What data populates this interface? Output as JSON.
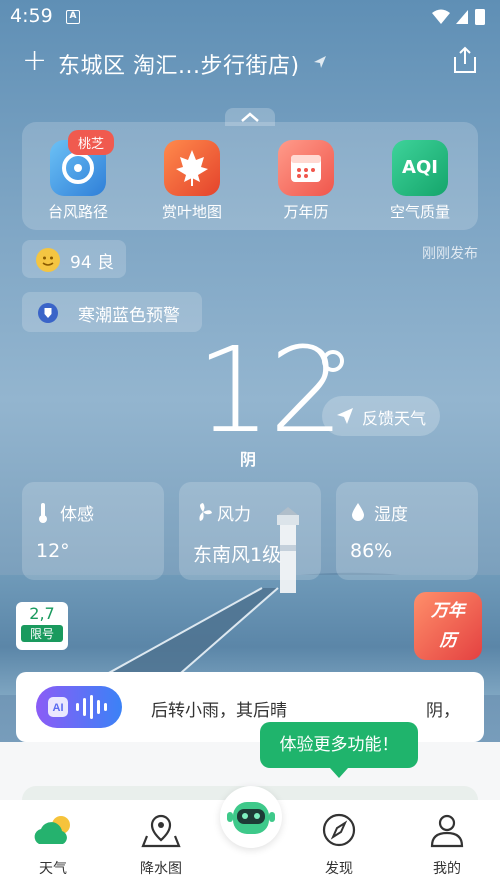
{
  "status_bar": {
    "time": "4:59",
    "notif_letter": "A"
  },
  "header": {
    "add_label": "+",
    "location": "东城区 淘汇...步行街店)"
  },
  "shortcuts": {
    "badge": "桃芝",
    "items": [
      {
        "label": "台风路径",
        "icon": "typhoon-icon"
      },
      {
        "label": "赏叶地图",
        "icon": "maple-leaf-icon"
      },
      {
        "label": "万年历",
        "icon": "calendar-icon"
      },
      {
        "label": "空气质量",
        "icon": "aqi-icon",
        "icon_text": "AQI"
      }
    ]
  },
  "aqi": {
    "value": "94",
    "level": "良"
  },
  "published": "刚刚发布",
  "alert": {
    "text": "寒潮蓝色预警"
  },
  "current": {
    "temperature": "12",
    "condition": "阴"
  },
  "feedback": {
    "label": "反馈天气"
  },
  "details": [
    {
      "title": "体感",
      "value": "12°",
      "icon": "thermometer-icon"
    },
    {
      "title": "风力",
      "value": "东南风1级",
      "icon": "fan-icon"
    },
    {
      "title": "湿度",
      "value": "86%",
      "icon": "water-drop-icon"
    }
  ],
  "traffic_restriction": {
    "numbers": "2,7",
    "label": "限号"
  },
  "calendar_ad": {
    "line1": "万年",
    "line2": "历"
  },
  "ai_bar": {
    "ai_label": "AI",
    "text": "后转小雨，其后晴",
    "text2": "阴，"
  },
  "tooltip": {
    "text": "体验更多功能！"
  },
  "tabs": [
    {
      "label": "天气",
      "icon": "weather-icon"
    },
    {
      "label": "降水图",
      "icon": "map-pin-icon"
    },
    {
      "label": "发现",
      "icon": "compass-icon"
    },
    {
      "label": "我的",
      "icon": "user-icon"
    }
  ],
  "colors": {
    "accent_green": "#1fb46c",
    "alert_blue": "#3a64c8",
    "badge_red": "#f05a4f"
  }
}
